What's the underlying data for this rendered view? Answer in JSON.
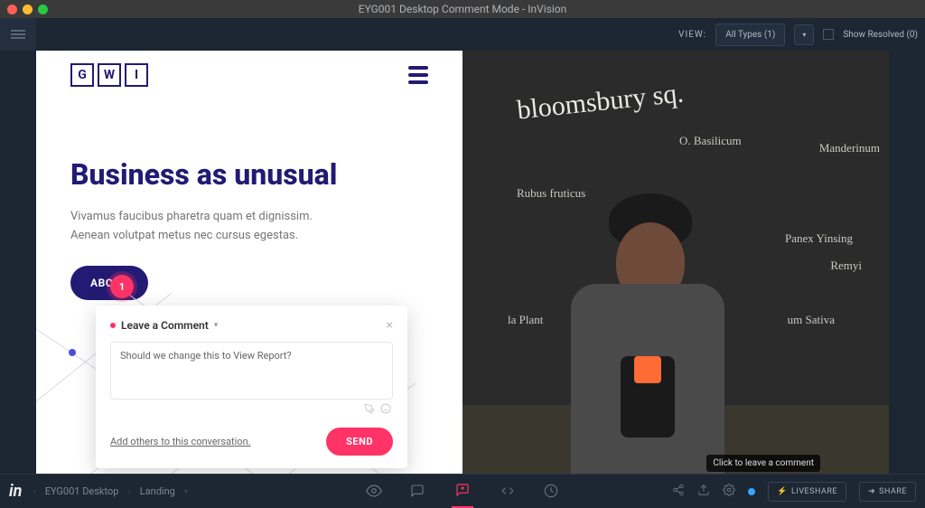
{
  "window": {
    "title": "EYG001 Desktop Comment Mode - InVision"
  },
  "topbar": {
    "view_label": "VIEW:",
    "filter": "All Types (1)",
    "show_resolved": "Show Resolved (0)"
  },
  "mock": {
    "logo_letters": [
      "G",
      "W",
      "I"
    ],
    "headline": "Business as unusual",
    "paragraph": "Vivamus faucibus pharetra quam et dignissim. Aenean volutpat metus nec cursus egestas.",
    "about_label": "ABOUT",
    "marker_num": "1"
  },
  "comment": {
    "title": "Leave a Comment",
    "text": "Should we change this to View Report?",
    "add_link": "Add others to this conversation.",
    "send_label": "SEND"
  },
  "chalkboard": {
    "banner": "bloomsbury sq.",
    "plants": [
      "O. Basilicum",
      "Manderinum",
      "Rubus fruticus",
      "Panex Yinsing",
      "Remyi",
      "la Plant",
      "um Sativa"
    ]
  },
  "tooltip": "Click to leave a comment",
  "bottom": {
    "logo": "in",
    "crumb1": "EYG001 Desktop",
    "crumb2": "Landing",
    "liveshare": "LIVESHARE",
    "share": "SHARE"
  }
}
